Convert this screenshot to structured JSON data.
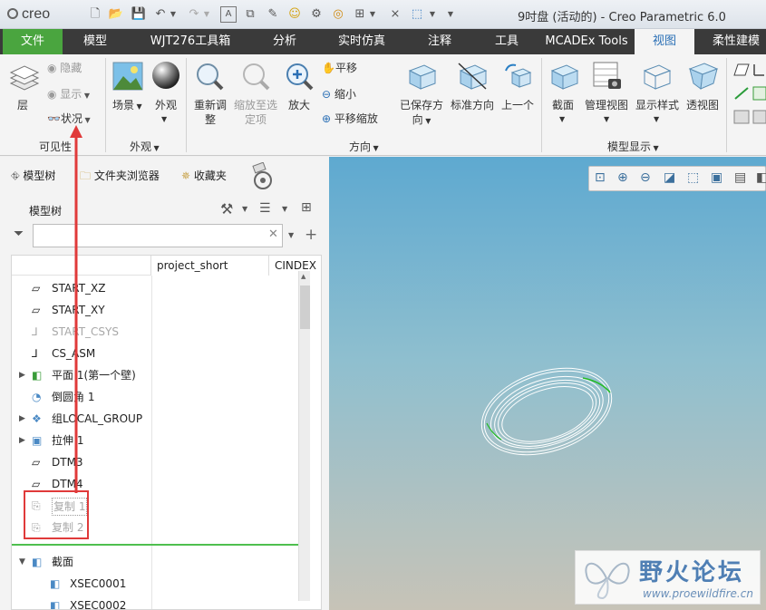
{
  "app": {
    "logo_text": "creo",
    "window_title": "9吋盘 (活动的) - Creo Parametric 6.0"
  },
  "quick_access": [
    "new-icon",
    "open-icon",
    "save-icon",
    "undo-icon",
    "redo-icon",
    "regenerate-icon",
    "windows-icon",
    "smile-icon",
    "gear-icon",
    "target-icon",
    "copy-icon",
    "close-small-icon",
    "view-cube-icon",
    "dropdown-icon"
  ],
  "tabs": [
    {
      "label": "文件"
    },
    {
      "label": "模型"
    },
    {
      "label": "WJT276工具箱"
    },
    {
      "label": "分析"
    },
    {
      "label": "实时仿真"
    },
    {
      "label": "注释"
    },
    {
      "label": "工具"
    },
    {
      "label": "MCADEx Tools"
    },
    {
      "label": "视图"
    },
    {
      "label": "柔性建模"
    }
  ],
  "ribbon": {
    "visibility": {
      "layer": "层",
      "hide": "隐藏",
      "show": "显示",
      "status": "状况",
      "group": "可见性"
    },
    "appearance": {
      "scene": "场景",
      "appearance": "外观",
      "group": "外观"
    },
    "orientation": {
      "repaint_1": "重新调",
      "repaint_2": "整",
      "zoom_fit_1": "缩放至选",
      "zoom_fit_2": "定项",
      "zoom_in": "放大",
      "pan": "平移",
      "zoom_out": "缩小",
      "pan_zoom": "平移缩放",
      "saved_1": "已保存方",
      "saved_2": "向",
      "standard": "标准方向",
      "previous": "上一个",
      "group": "方向"
    },
    "model_display": {
      "section": "截面",
      "manage": "管理视图",
      "display_style": "显示样式",
      "perspective": "透视图",
      "group": "模型显示"
    }
  },
  "panel": {
    "tabs": {
      "model_tree": "模型树",
      "folder": "文件夹浏览器",
      "favorites": "收藏夹"
    },
    "heading": "模型树",
    "filter_value": "",
    "columns": {
      "c1": "project_short",
      "c2": "CINDEX"
    },
    "rows": [
      {
        "label": "START_XZ",
        "icon": "plane-icon",
        "disabled": false
      },
      {
        "label": "START_XY",
        "icon": "plane-icon",
        "disabled": false
      },
      {
        "label": "START_CSYS",
        "icon": "csys-icon",
        "disabled": true
      },
      {
        "label": "CS_ASM",
        "icon": "csys-icon",
        "disabled": false
      },
      {
        "label": "平面 1(第一个壁)",
        "icon": "sheetmetal-icon",
        "disabled": false
      },
      {
        "label": "倒圆角 1",
        "icon": "round-icon",
        "disabled": false
      },
      {
        "label": "组LOCAL_GROUP",
        "icon": "group-icon",
        "disabled": false
      },
      {
        "label": "拉伸 1",
        "icon": "extrude-icon",
        "disabled": false
      },
      {
        "label": "DTM3",
        "icon": "plane-icon",
        "disabled": false
      },
      {
        "label": "DTM4",
        "icon": "plane-icon",
        "disabled": false
      },
      {
        "label": "复制 1",
        "icon": "copy-feature-icon",
        "disabled": true
      },
      {
        "label": "复制 2",
        "icon": "copy-feature-icon",
        "disabled": true
      }
    ],
    "sections": {
      "label": "截面",
      "items": [
        "XSEC0001",
        "XSEC0002"
      ]
    }
  },
  "watermark": {
    "title": "野火论坛",
    "url": "www.proewildfire.cn"
  },
  "colors": {
    "file_tab": "#4aa53f",
    "tab_bar": "#3a3a3a",
    "active_tab_text": "#2a6fb5",
    "annotation_red": "#e03a3a",
    "model_edge": "#ffffff",
    "model_highlight": "#22bb22"
  }
}
